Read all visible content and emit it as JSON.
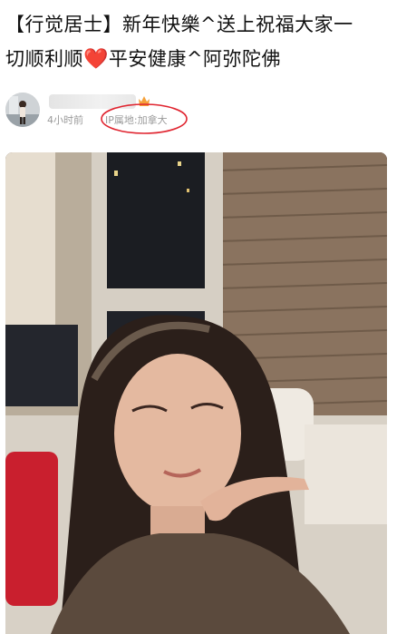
{
  "post": {
    "line1": "【行觉居士】新年快樂^送上祝福大家一",
    "line2_before": "切顺利顺",
    "heart": "❤️",
    "line2_after": "平安健康^阿弥陀佛"
  },
  "author": {
    "avatar_icon": "user-avatar-icon",
    "badge_icon": "vip-crown-icon",
    "time": "4小时前",
    "ip_location": "IP属地:加拿大"
  },
  "annotation": {
    "color": "#e0242f"
  }
}
